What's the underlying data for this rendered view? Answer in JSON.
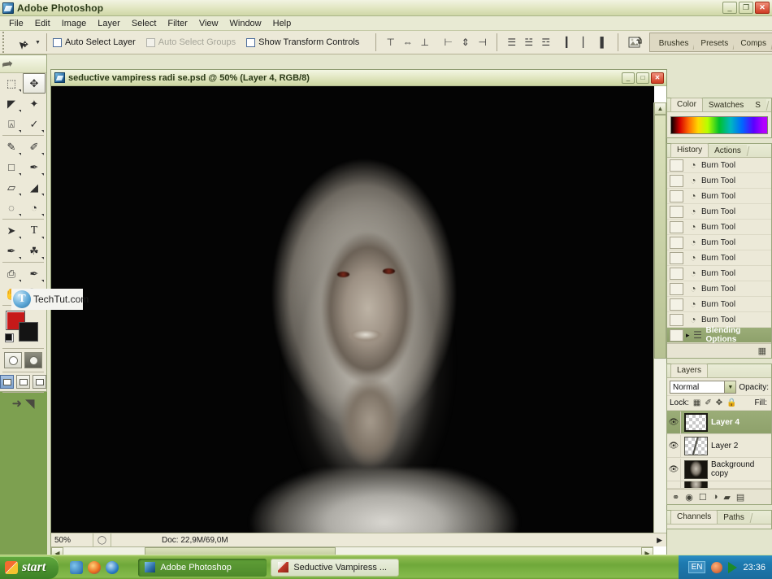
{
  "app": {
    "title": "Adobe Photoshop",
    "window_buttons": {
      "minimize": "_",
      "restore": "❐",
      "close": "✕"
    }
  },
  "menubar": {
    "items": [
      {
        "label": "File"
      },
      {
        "label": "Edit"
      },
      {
        "label": "Image"
      },
      {
        "label": "Layer"
      },
      {
        "label": "Select"
      },
      {
        "label": "Filter"
      },
      {
        "label": "View"
      },
      {
        "label": "Window"
      },
      {
        "label": "Help"
      }
    ]
  },
  "options_bar": {
    "tool": "move-tool",
    "checkboxes": [
      {
        "label": "Auto Select Layer",
        "checked": false,
        "enabled": true
      },
      {
        "label": "Auto Select Groups",
        "checked": false,
        "enabled": false
      },
      {
        "label": "Show Transform Controls",
        "checked": false,
        "enabled": true
      }
    ],
    "align_buttons": [
      "align-top-edges",
      "align-vertical-centers",
      "align-bottom-edges",
      "align-left-edges",
      "align-horizontal-centers",
      "align-right-edges"
    ],
    "distribute_buttons": [
      "distribute-top-edges",
      "distribute-vertical-centers",
      "distribute-bottom-edges",
      "distribute-left-edges",
      "distribute-horizontal-centers",
      "distribute-right-edges"
    ],
    "palette_well": {
      "icon": "image-ready-icon",
      "tabs": [
        "Brushes",
        "Presets",
        "Comps"
      ]
    }
  },
  "toolbox": {
    "rows": [
      [
        {
          "icon": "rectangular-marquee-tool",
          "glyph": "⬚",
          "selected": false,
          "more": true
        },
        {
          "icon": "move-tool",
          "glyph": "✥",
          "selected": true,
          "more": false
        }
      ],
      [
        {
          "icon": "lasso-tool",
          "glyph": "✁",
          "selected": false,
          "more": true
        },
        {
          "icon": "magic-wand-tool",
          "glyph": "✦",
          "selected": false,
          "more": false
        }
      ],
      [
        {
          "icon": "crop-tool",
          "glyph": "⌗",
          "selected": false,
          "more": true
        },
        {
          "icon": "slice-tool",
          "glyph": "✄",
          "selected": false,
          "more": true
        }
      ],
      [
        {
          "icon": "healing-brush-tool",
          "glyph": "✎",
          "selected": false,
          "more": true
        },
        {
          "icon": "brush-tool",
          "glyph": "✐",
          "selected": false,
          "more": true
        }
      ],
      [
        {
          "icon": "clone-stamp-tool",
          "glyph": "⚑",
          "selected": false,
          "more": true
        },
        {
          "icon": "history-brush-tool",
          "glyph": "✒",
          "selected": false,
          "more": true
        }
      ],
      [
        {
          "icon": "eraser-tool",
          "glyph": "▱",
          "selected": false,
          "more": true
        },
        {
          "icon": "gradient-tool",
          "glyph": "◢",
          "selected": false,
          "more": true
        }
      ],
      [
        {
          "icon": "blur-tool",
          "glyph": "◌",
          "selected": false,
          "more": true
        },
        {
          "icon": "dodge-burn-tool",
          "glyph": "◔",
          "selected": false,
          "more": true
        }
      ],
      [
        {
          "icon": "path-selection-tool",
          "glyph": "➤",
          "selected": false,
          "more": true
        },
        {
          "icon": "type-tool",
          "glyph": "T",
          "selected": false,
          "more": true
        }
      ],
      [
        {
          "icon": "pen-tool",
          "glyph": "✒",
          "selected": false,
          "more": true
        },
        {
          "icon": "custom-shape-tool",
          "glyph": "♣",
          "selected": false,
          "more": true
        }
      ],
      [
        {
          "icon": "notes-tool",
          "glyph": "Ὕ2",
          "selected": false,
          "more": true
        },
        {
          "icon": "eyedropper-tool",
          "glyph": "⚗",
          "selected": false,
          "more": true
        }
      ],
      [
        {
          "icon": "hand-tool",
          "glyph": "✋",
          "selected": false,
          "more": false
        },
        {
          "icon": "zoom-tool",
          "glyph": "⚲",
          "selected": false,
          "more": false
        }
      ]
    ],
    "foreground_color": "#c61919",
    "background_color": "#141414",
    "mask_modes": [
      "standard-mask-mode",
      "quick-mask-mode"
    ],
    "screen_modes": [
      "standard-screen-mode",
      "full-screen-with-menubar",
      "full-screen-mode"
    ],
    "jump_to": "jump-to-imageready"
  },
  "watermark": {
    "text": "TechTut.com",
    "logo_letter": "T"
  },
  "document": {
    "title": "seductive vampiress radi se.psd @ 50% (Layer 4, RGB/8)",
    "window_buttons": {
      "minimize": "_",
      "maximize": "□",
      "close": "✕"
    },
    "status": {
      "zoom": "50%",
      "doc_info": "Doc: 22,9M/69,0M"
    }
  },
  "color_palette": {
    "tabs": [
      {
        "label": "Color",
        "active": true
      },
      {
        "label": "Swatches",
        "active": false
      },
      {
        "label": "S",
        "active": false
      }
    ]
  },
  "history_palette": {
    "tabs": [
      {
        "label": "History",
        "active": true
      },
      {
        "label": "Actions",
        "active": false
      }
    ],
    "items": [
      {
        "label": "Burn Tool",
        "selected": false
      },
      {
        "label": "Burn Tool",
        "selected": false
      },
      {
        "label": "Burn Tool",
        "selected": false
      },
      {
        "label": "Burn Tool",
        "selected": false
      },
      {
        "label": "Burn Tool",
        "selected": false
      },
      {
        "label": "Burn Tool",
        "selected": false
      },
      {
        "label": "Burn Tool",
        "selected": false
      },
      {
        "label": "Burn Tool",
        "selected": false
      },
      {
        "label": "Burn Tool",
        "selected": false
      },
      {
        "label": "Burn Tool",
        "selected": false
      },
      {
        "label": "Burn Tool",
        "selected": false
      },
      {
        "label": "Blending Options",
        "selected": true
      }
    ]
  },
  "layers_palette": {
    "tabs": [
      {
        "label": "Layers",
        "active": true
      }
    ],
    "blend_mode": "Normal",
    "opacity_label": "Opacity:",
    "lock_label": "Lock:",
    "fill_label": "Fill:",
    "lock_icons": [
      "lock-transparent-pixels",
      "lock-image-pixels",
      "lock-position",
      "lock-all"
    ],
    "layers": [
      {
        "name": "Layer 4",
        "selected": true,
        "visible": true,
        "thumb": "transparent"
      },
      {
        "name": "Layer 2",
        "selected": false,
        "visible": true,
        "thumb": "brushmark"
      },
      {
        "name": "Background copy",
        "selected": false,
        "visible": true,
        "thumb": "photo1"
      },
      {
        "name": "",
        "selected": false,
        "visible": true,
        "thumb": "photo2"
      }
    ],
    "footer_icons": [
      "link-layers",
      "layer-style",
      "layer-mask",
      "adjustment-layer",
      "new-group",
      "new-layer"
    ]
  },
  "bottom_palette": {
    "tabs": [
      {
        "label": "Channels",
        "active": true
      },
      {
        "label": "Paths",
        "active": false
      }
    ]
  },
  "taskbar": {
    "start_label": "start",
    "quick_launch": [
      "outlook-icon",
      "firefox-icon",
      "internet-explorer-icon"
    ],
    "tasks": [
      {
        "label": "Adobe Photoshop",
        "active": true,
        "icon": "photoshop-icon"
      },
      {
        "label": "Seductive Vampiress ...",
        "active": false,
        "icon": "folder-icon"
      }
    ],
    "tray": {
      "language": "EN",
      "icons": [
        "security-shield-icon",
        "media-play-icon"
      ],
      "clock": "23:36"
    }
  }
}
